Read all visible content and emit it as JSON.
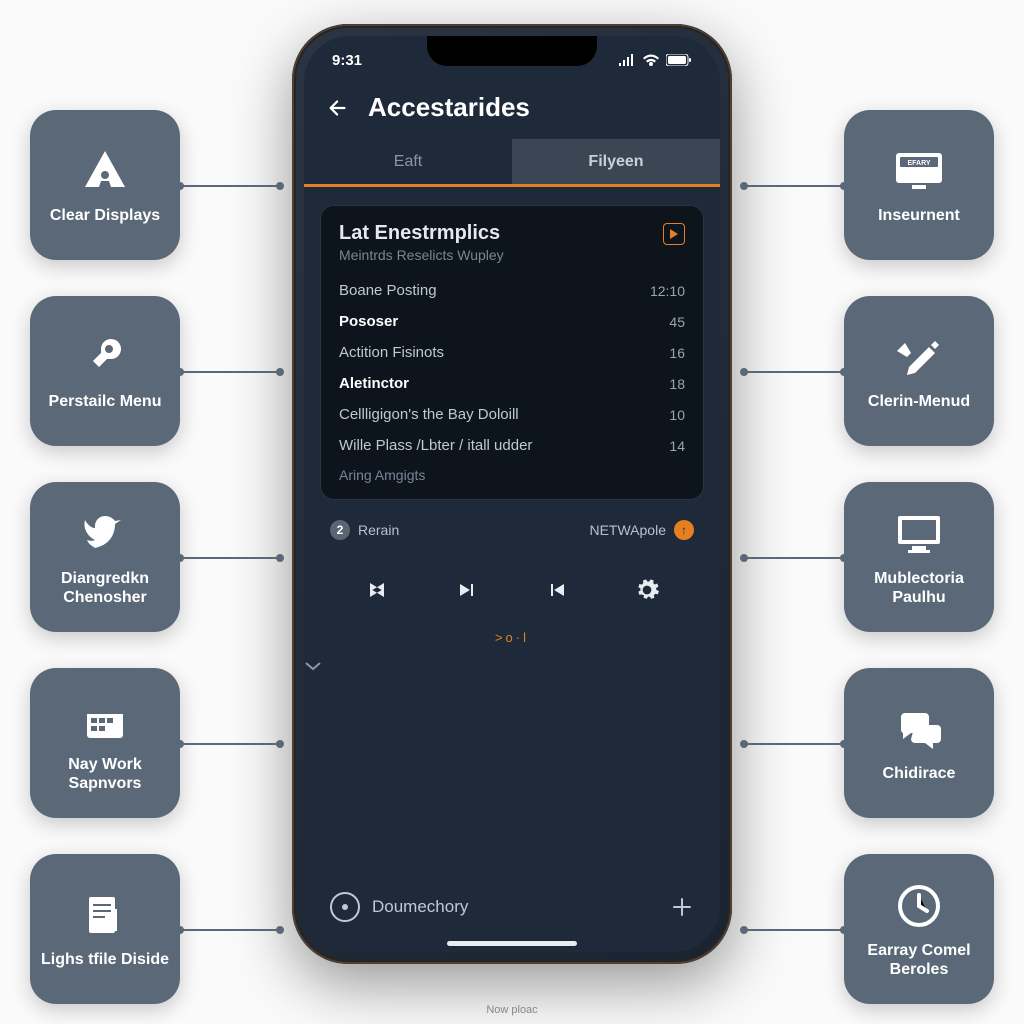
{
  "status_bar": {
    "time": "9:31"
  },
  "header": {
    "title": "Accestarides"
  },
  "tabs": [
    {
      "label": "Eaft",
      "active": false
    },
    {
      "label": "Filyeen",
      "active": true
    }
  ],
  "card": {
    "title": "Lat Enestrmplics",
    "subtitle": "Meintrds Reselicts Wupley",
    "rows": [
      {
        "label": "Boane Posting",
        "value": "12:10",
        "bold": false
      },
      {
        "label": "Pososer",
        "value": "45",
        "bold": true
      },
      {
        "label": "Actition Fisinots",
        "value": "16",
        "bold": false
      },
      {
        "label": "Aletinctor",
        "value": "18",
        "bold": true
      },
      {
        "label": "Cellligigon's the Bay Doloill",
        "value": "10",
        "bold": false
      },
      {
        "label": "Wille Plass /Lbter / itall udder",
        "value": "14",
        "bold": false
      }
    ],
    "extra": "Aring Amgigts"
  },
  "status_row": {
    "left_badge": "2",
    "left_label": "Rerain",
    "right_label": "NETWApole",
    "right_badge": "↑"
  },
  "scrub_text": ">o·l",
  "bottom": {
    "label": "Doumechory"
  },
  "caption": "Now ploac",
  "tiles_left": [
    {
      "label": "Clear Displays",
      "icon": "warning-person"
    },
    {
      "label": "Perstailc Menu",
      "icon": "plug"
    },
    {
      "label": "Diangredkn Chenosher",
      "icon": "bird"
    },
    {
      "label": "Nay Work Sapnvors",
      "icon": "calendar"
    },
    {
      "label": "Lighs tfile Diside",
      "icon": "document"
    }
  ],
  "tiles_right": [
    {
      "label": "Inseurnent",
      "icon": "monitor-badge",
      "badge": "EFARY"
    },
    {
      "label": "Clerin-Menud",
      "icon": "tool"
    },
    {
      "label": "Mublectoria Paulhu",
      "icon": "monitor"
    },
    {
      "label": "Chidirace",
      "icon": "chat"
    },
    {
      "label": "Earray Comel Beroles",
      "icon": "clock"
    }
  ],
  "colors": {
    "accent": "#e67e22",
    "tile": "#5a6878",
    "phone_bg": "#1e2a3a"
  }
}
